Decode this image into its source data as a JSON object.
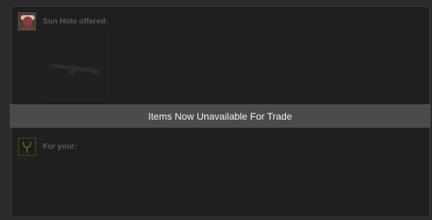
{
  "trade_offer": {
    "offerer": {
      "name_label": "Sun Holo offered:"
    },
    "recipient": {
      "label": "For your:"
    },
    "status_banner": "Items Now Unavailable For Trade"
  }
}
